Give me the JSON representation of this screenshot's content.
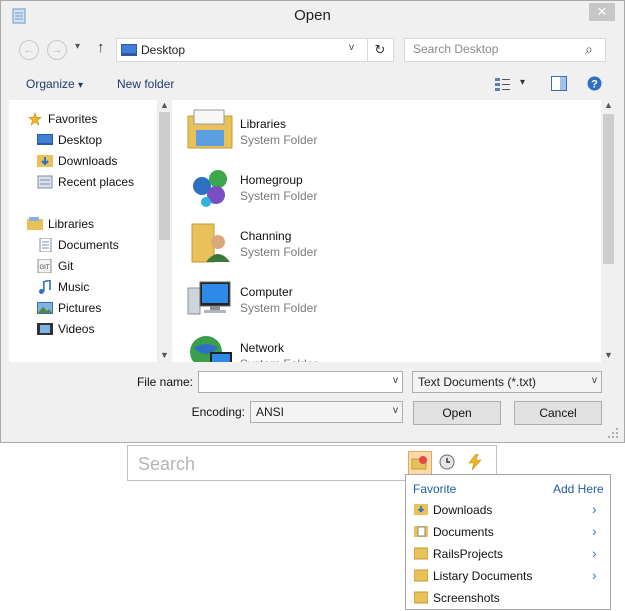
{
  "window": {
    "title": "Open",
    "close_glyph": "✕"
  },
  "nav": {
    "back_glyph": "←",
    "forward_glyph": "→",
    "up_glyph": "↑",
    "address": "Desktop",
    "dropdown_glyph": "v",
    "refresh_glyph": "↻",
    "search_placeholder": "Search Desktop",
    "search_icon_glyph": "⌕"
  },
  "toolbar": {
    "organize_label": "Organize",
    "new_folder_label": "New folder",
    "caret": "▾"
  },
  "sidebar": {
    "groups": [
      {
        "label": "Favorites",
        "icon": "star-icon",
        "items": [
          {
            "label": "Desktop",
            "icon": "desktop-icon"
          },
          {
            "label": "Downloads",
            "icon": "downloads-folder-icon"
          },
          {
            "label": "Recent places",
            "icon": "recent-places-icon"
          }
        ]
      },
      {
        "label": "Libraries",
        "icon": "libraries-icon",
        "items": [
          {
            "label": "Documents",
            "icon": "documents-icon"
          },
          {
            "label": "Git",
            "icon": "git-icon"
          },
          {
            "label": "Music",
            "icon": "music-icon"
          },
          {
            "label": "Pictures",
            "icon": "pictures-icon"
          },
          {
            "label": "Videos",
            "icon": "videos-icon"
          }
        ]
      }
    ]
  },
  "files": [
    {
      "name": "Libraries",
      "type": "System Folder",
      "icon": "libraries-folder-icon"
    },
    {
      "name": "Homegroup",
      "type": "System Folder",
      "icon": "homegroup-icon"
    },
    {
      "name": "Channing",
      "type": "System Folder",
      "icon": "user-folder-icon"
    },
    {
      "name": "Computer",
      "type": "System Folder",
      "icon": "computer-icon"
    },
    {
      "name": "Network",
      "type": "System Folder",
      "icon": "network-icon"
    }
  ],
  "form": {
    "file_name_label": "File name:",
    "file_name_value": "",
    "file_type_value": "Text Documents (*.txt)",
    "encoding_label": "Encoding:",
    "encoding_value": "ANSI",
    "open_label": "Open",
    "cancel_label": "Cancel"
  },
  "listary": {
    "search_placeholder": "Search",
    "menu": {
      "header_label": "Favorite",
      "add_here_label": "Add Here",
      "items": [
        {
          "label": "Downloads",
          "icon": "downloads-folder-icon",
          "has_submenu": true
        },
        {
          "label": "Documents",
          "icon": "documents-folder-icon",
          "has_submenu": true
        },
        {
          "label": "RailsProjects",
          "icon": "folder-icon",
          "has_submenu": true
        },
        {
          "label": "Listary Documents",
          "icon": "folder-icon",
          "has_submenu": true
        },
        {
          "label": "Screenshots",
          "icon": "folder-icon",
          "has_submenu": false
        }
      ],
      "chevron_glyph": "›"
    }
  },
  "colors": {
    "link_blue": "#1e5fa8",
    "window_bg": "#f0f0f0",
    "folder_yellow": "#e8c15a"
  }
}
